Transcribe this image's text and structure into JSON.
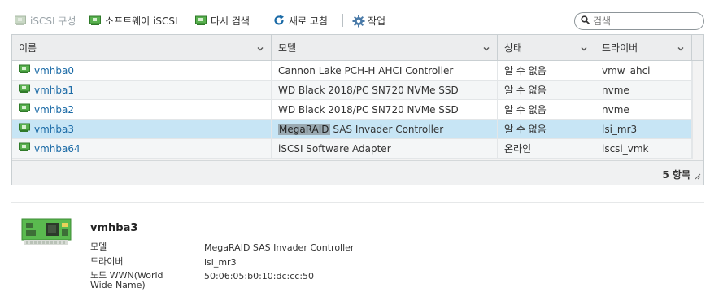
{
  "toolbar": {
    "iscsi_label": "iSCSI 구성",
    "software_iscsi_label": "소프트웨어 iSCSI",
    "rescan_label": "다시 검색",
    "refresh_label": "새로 고침",
    "actions_label": "작업",
    "search_placeholder": "검색"
  },
  "table": {
    "columns": [
      "이름",
      "모델",
      "상태",
      "드라이버"
    ],
    "rows": [
      {
        "name": "vmhba0",
        "model": "Cannon Lake PCH-H AHCI Controller",
        "status": "알 수 없음",
        "driver": "vmw_ahci"
      },
      {
        "name": "vmhba1",
        "model": "WD Black 2018/PC SN720 NVMe SSD",
        "status": "알 수 없음",
        "driver": "nvme"
      },
      {
        "name": "vmhba2",
        "model": "WD Black 2018/PC SN720 NVMe SSD",
        "status": "알 수 없음",
        "driver": "nvme"
      },
      {
        "name": "vmhba3",
        "model_hl": "MegaRAID",
        "model_rest": " SAS Invader Controller",
        "status": "알 수 없음",
        "driver": "lsi_mr3"
      },
      {
        "name": "vmhba64",
        "model": "iSCSI Software Adapter",
        "status": "온라인",
        "driver": "iscsi_vmk"
      }
    ],
    "count": "5 항목"
  },
  "detail": {
    "title": "vmhba3",
    "model_label": "모델",
    "model_value": "MegaRAID SAS Invader Controller",
    "driver_label": "드라이버",
    "driver_value": "lsi_mr3",
    "wwn_label_1": "노드 WWN(World",
    "wwn_label_2": "Wide Name)",
    "wwn_value": "50:06:05:b0:10:dc:cc:50"
  },
  "colors": {
    "link": "#1a6aa6",
    "selected_row": "#c7e5f5",
    "icon_green": "#3f9a3a"
  },
  "icons": [
    "hba-icon",
    "refresh-icon",
    "gear-icon",
    "search-icon",
    "chevron-down-icon",
    "resize-icon"
  ]
}
